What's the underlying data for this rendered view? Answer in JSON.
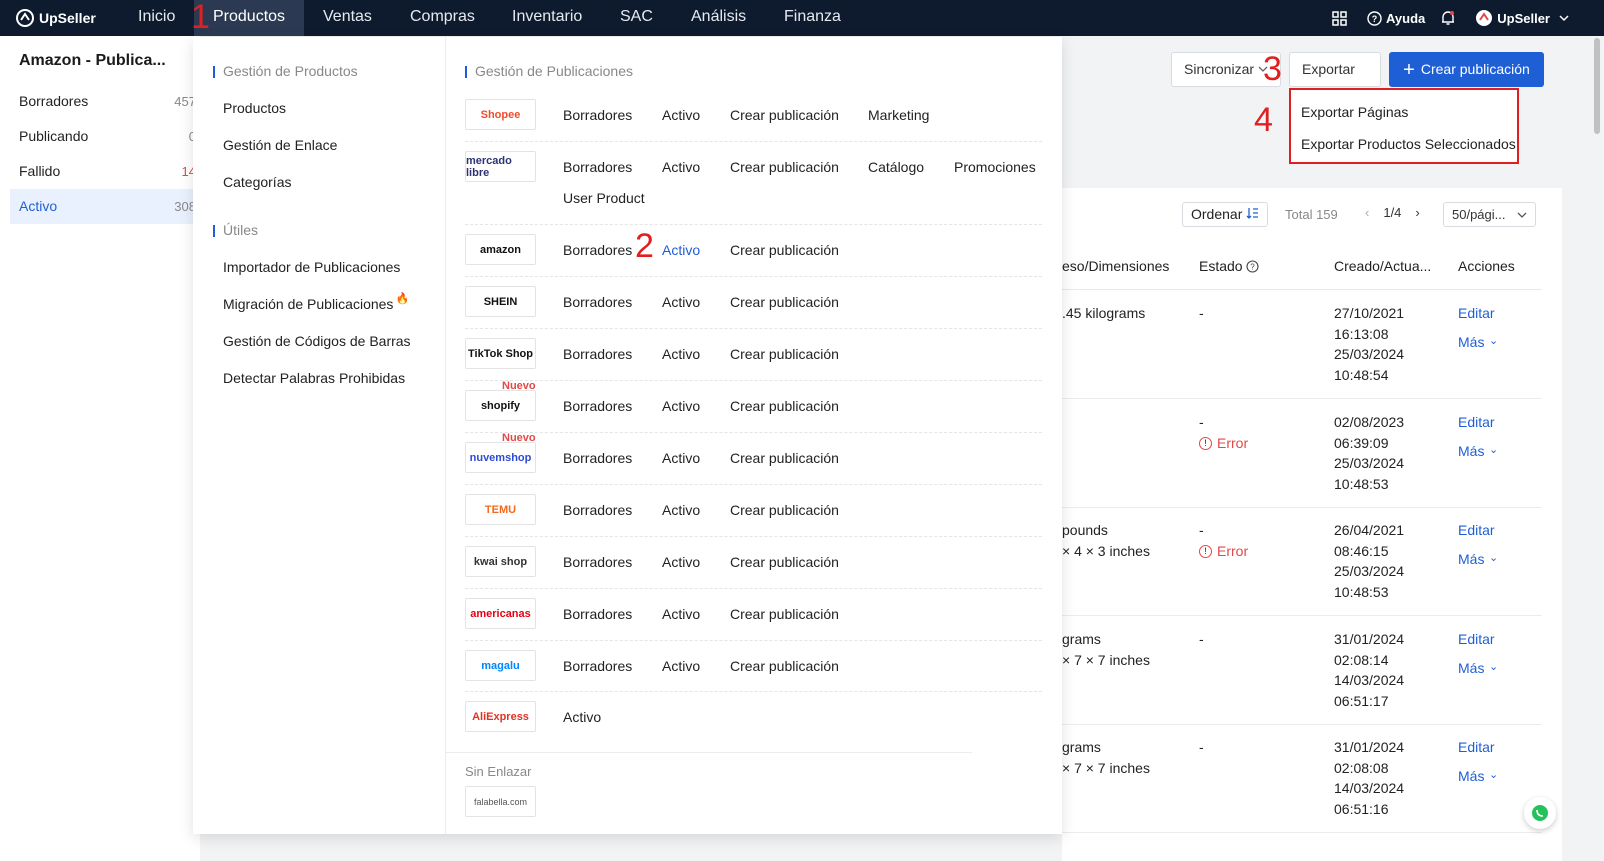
{
  "brand": "UpSeller",
  "nav": [
    "Inicio",
    "Productos",
    "Ventas",
    "Compras",
    "Inventario",
    "SAC",
    "Análisis",
    "Finanza"
  ],
  "right_tools": {
    "help": "Ayuda",
    "account": "UpSeller"
  },
  "annotations": [
    "1",
    "2",
    "3",
    "4"
  ],
  "sidebar": {
    "title": "Amazon - Publica...",
    "items": [
      {
        "label": "Borradores",
        "count": "457"
      },
      {
        "label": "Publicando",
        "count": "0"
      },
      {
        "label": "Fallido",
        "count": "14"
      },
      {
        "label": "Activo",
        "count": "308"
      }
    ]
  },
  "toolbar": {
    "sync": "Sincronizar",
    "export": "Exportar",
    "create": "Crear publicación",
    "export_menu": [
      "Exportar Páginas",
      "Exportar Productos Seleccionados"
    ],
    "sort": "Ordenar",
    "total": "Total 159",
    "page": "1/4",
    "page_size": "50/pági..."
  },
  "table": {
    "headers": [
      "eso/Dimensiones",
      "Estado",
      "Creado/Actua...",
      "Acciones"
    ],
    "rows": [
      {
        "dims": ".45 kilograms",
        "estado": "-",
        "error": "",
        "dates": "27/10/2021\n16:13:08\n25/03/2024\n10:48:54"
      },
      {
        "dims": "",
        "estado": "-",
        "error": "Error",
        "dates": "02/08/2023\n06:39:09\n25/03/2024\n10:48:53"
      },
      {
        "dims": "pounds\n× 4 × 3 inches",
        "estado": "-",
        "error": "Error",
        "dates": "26/04/2021\n08:46:15\n25/03/2024\n10:48:53"
      },
      {
        "dims": "grams\n× 7 × 7 inches",
        "estado": "-",
        "error": "",
        "dates": "31/01/2024\n02:08:14\n14/03/2024\n06:51:17"
      },
      {
        "dims": "grams\n× 7 × 7 inches",
        "estado": "-",
        "error": "",
        "dates": "31/01/2024\n02:08:08\n14/03/2024\n06:51:16"
      }
    ],
    "edit": "Editar",
    "more": "Más"
  },
  "mega": {
    "gestion_productos_title": "Gestión de Productos",
    "gestion_productos": [
      "Productos",
      "Gestión de Enlace",
      "Categorías"
    ],
    "utiles_title": "Útiles",
    "utiles": [
      "Importador de Publicaciones",
      "Migración de Publicaciones",
      "Gestión de Códigos de Barras",
      "Detectar Palabras Prohibidas"
    ],
    "publicaciones_title": "Gestión de Publicaciones",
    "platforms": [
      {
        "logo": "Shopee",
        "color": "#ee4d2d",
        "links": [
          "Borradores",
          "Activo",
          "Crear publicación",
          "Marketing"
        ]
      },
      {
        "logo": "mercado libre",
        "color": "#2d3277",
        "links": [
          "Borradores",
          "Activo",
          "Crear publicación",
          "Catálogo",
          "Promociones",
          "User Product"
        ]
      },
      {
        "logo": "amazon",
        "color": "#111111",
        "links": [
          "Borradores",
          "Activo",
          "Crear publicación"
        ]
      },
      {
        "logo": "SHEIN",
        "color": "#111111",
        "links": [
          "Borradores",
          "Activo",
          "Crear publicación"
        ]
      },
      {
        "logo": "TikTok Shop",
        "color": "#111111",
        "links": [
          "Borradores",
          "Activo",
          "Crear publicación"
        ]
      },
      {
        "logo": "shopify",
        "color": "#111111",
        "badge": "Nuevo",
        "links": [
          "Borradores",
          "Activo",
          "Crear publicación"
        ]
      },
      {
        "logo": "nuvemshop",
        "color": "#2c4bd6",
        "badge": "Nuevo",
        "links": [
          "Borradores",
          "Activo",
          "Crear publicación"
        ]
      },
      {
        "logo": "TEMU",
        "color": "#f26a1b",
        "links": [
          "Borradores",
          "Activo",
          "Crear publicación"
        ]
      },
      {
        "logo": "kwai shop",
        "color": "#333333",
        "links": [
          "Borradores",
          "Activo",
          "Crear publicación"
        ]
      },
      {
        "logo": "americanas",
        "color": "#e60014",
        "links": [
          "Borradores",
          "Activo",
          "Crear publicación"
        ]
      },
      {
        "logo": "magalu",
        "color": "#0086ff",
        "links": [
          "Borradores",
          "Activo",
          "Crear publicación"
        ]
      },
      {
        "logo": "AliExpress",
        "color": "#e43225",
        "links": [
          "Activo"
        ]
      }
    ],
    "sin_enlazar_title": "Sin Enlazar",
    "sin_enlazar_logo": "falabella.com"
  }
}
